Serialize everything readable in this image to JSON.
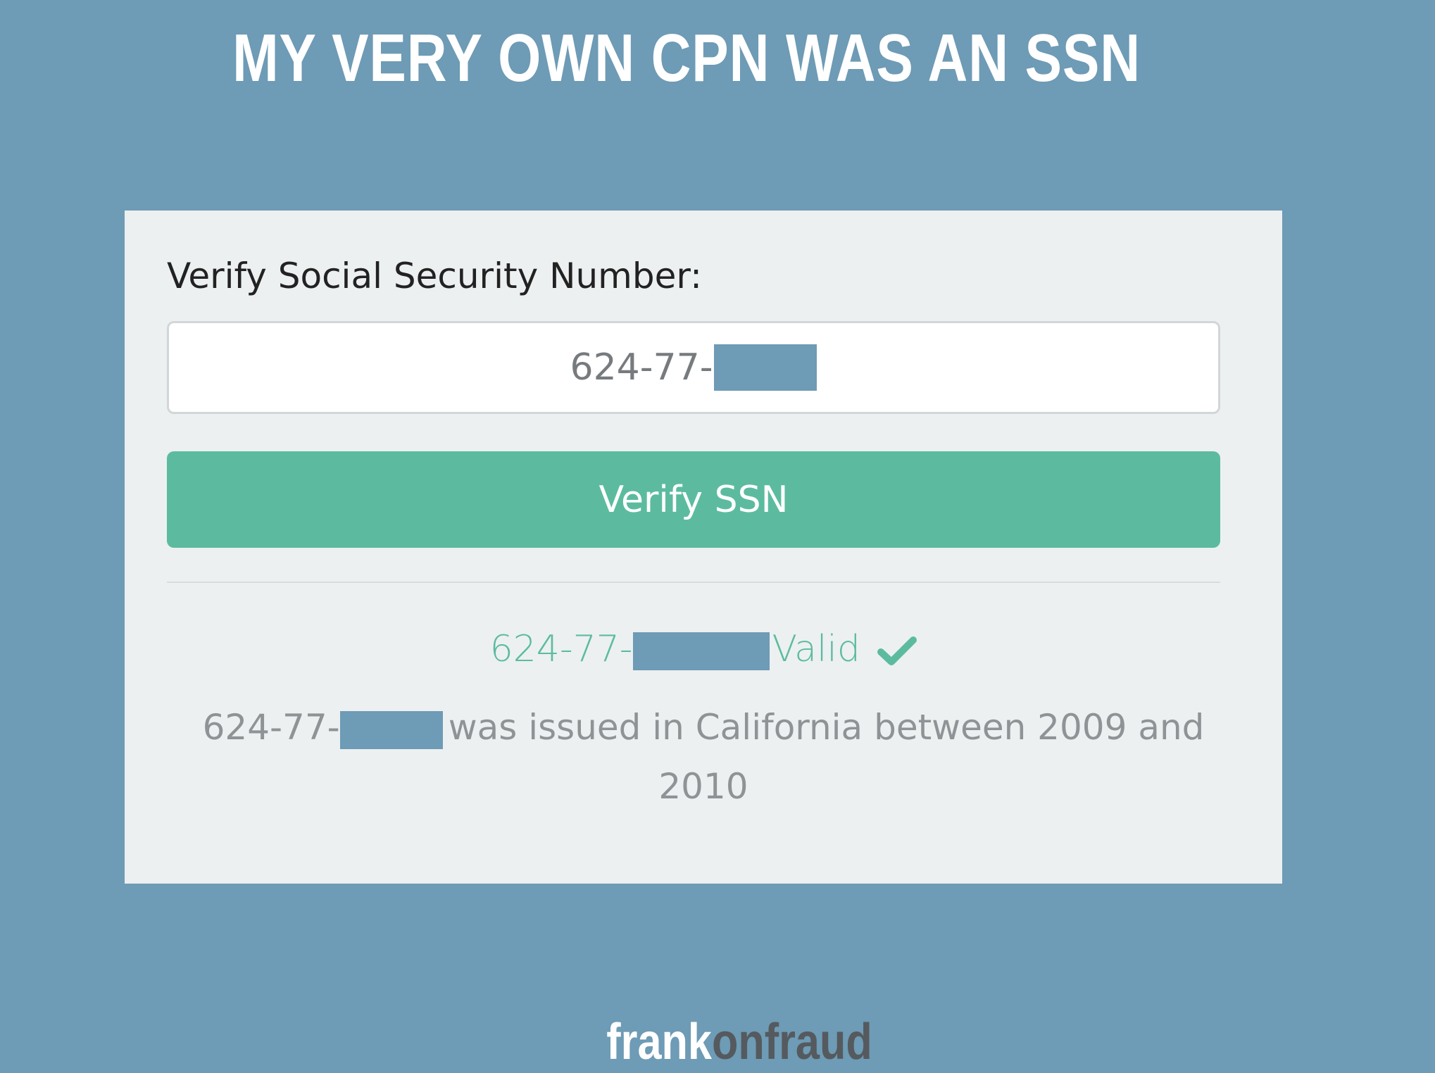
{
  "headline": "MY VERY OWN CPN WAS AN SSN",
  "form": {
    "label": "Verify Social Security Number:",
    "input_value_prefix": "624-77-",
    "button_label": "Verify SSN"
  },
  "result": {
    "ssn_prefix": "624-77-",
    "status": "Valid",
    "detail_prefix": "624-77-",
    "detail_text": "was issued in California between 2009 and 2010"
  },
  "footer": {
    "logo_part1": "frank",
    "logo_part2": "onfraud"
  },
  "colors": {
    "background": "#6e9bb5",
    "accent_green": "#5cbb9f",
    "card": "#ecf0f1"
  },
  "icons": {
    "status": "check-icon"
  }
}
